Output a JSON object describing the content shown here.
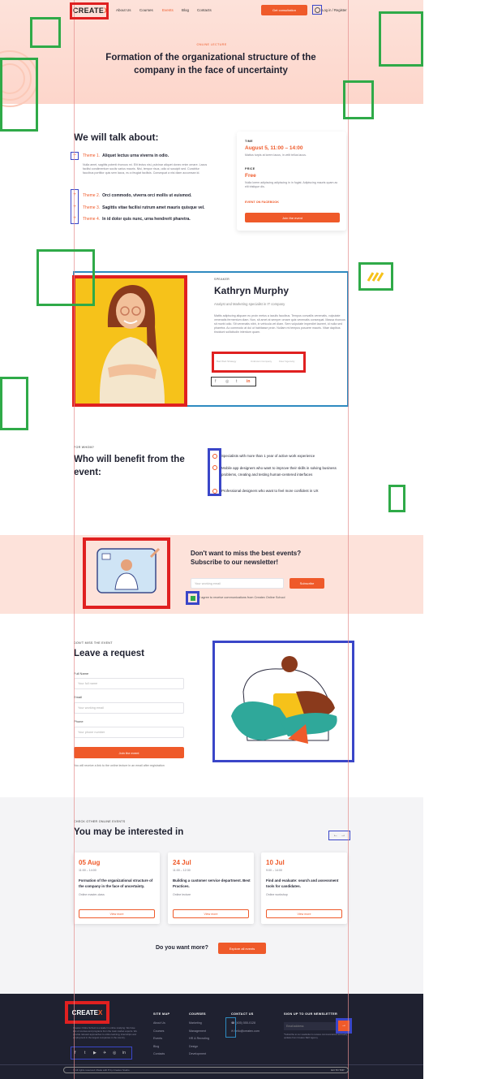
{
  "header": {
    "logo_main": "CREATE",
    "logo_x": "X",
    "nav": [
      "About Us",
      "Courses",
      "Events",
      "Blog",
      "Contacts"
    ],
    "consult_btn": "Get consultation",
    "login": "Log in / Register"
  },
  "hero": {
    "category": "ONLINE LECTURE",
    "title": "Formation of the organizational structure of the company in the face of uncertainty"
  },
  "talk": {
    "heading": "We will talk about:",
    "themes": [
      {
        "num": "Theme 1.",
        "text": "Aliquet lectus urna viverra in odio."
      },
      {
        "num": "Theme 2.",
        "text": "Orci commodo, viverra orci mollis ut euismod."
      },
      {
        "num": "Theme 3.",
        "text": "Sagittis vitae facilisi rutrum amet mauris quisque vel."
      },
      {
        "num": "Theme 4.",
        "text": "In id dolor quis nunc, urna hendrerit pharetra."
      }
    ],
    "theme1_desc": "Nulla amet, sagittis potenti rhoncus mi. Elit lectus nisi, pulvinar aliquet donec enim ornare. Lacus facilisi condimentum sociis varius mauris. Nisi, tempor risus, odio ut suscipit sed. Curabitur faucibus porttitor quis sem lacus, eu a feugiat facilisis. Consequat a nisi diam accumsan id."
  },
  "info_card": {
    "time_label": "TIME",
    "time_value": "August 5, 11:00 – 14:00",
    "time_desc": "Mattus turpis at lorem lacus, in velit tellus lacus.",
    "price_label": "PRICE",
    "price_value": "Free",
    "price_desc": "Nulla lorem adipiscing adipiscing in in fugiat. Adipiscing mauris quam ac elit tristique dis.",
    "facebook_link": "EVENT ON FACEBOOK",
    "join_btn": "Join the event"
  },
  "speaker": {
    "label": "SPEAKER",
    "name": "Kathryn Murphy",
    "role": "Analyst and Marketing specialist in IT company",
    "bio": "Mattis adipiscing aliquam eu proin metus a iaculis faucibus. Tempus convallis venenatis, vulputate venenatis fermentum diam. Non, sit amet at semper ornare quis venenatis consequat. Massa rhoncus sit morbi odio. Sit venenatis nibh, in vehicula vel diam. Sem vulputate imperdiet laoreet, id nulla sed pharetra. Ac commodo at dui ut habitasse proin. Nullam mi tempus posuere mauris. Vitae dapibus tincidunt sollicitudin interdum quam.",
    "partners": [
      "Bad Web Strategy",
      "Unknown Company",
      "Flow Ingenuity"
    ]
  },
  "benefit": {
    "label": "FOR WHOM?",
    "heading": "Who will benefit from the event:",
    "items": [
      "Specialists with more than 1 year of active work experience",
      "Mobile app designers who want to improve their skills in solving business problems, creating and testing human-centered interfaces",
      "Professional designers who want to feel more confident in UX"
    ]
  },
  "newsletter": {
    "heading": "Don't want to miss the best events? Subscribe to our newsletter!",
    "placeholder": "Your working email",
    "btn": "Subscribe",
    "agree": "I agree to receive communications from Createx Online School"
  },
  "request": {
    "label": "DON'T MISS THE EVENT",
    "heading": "Leave a request",
    "fields": [
      {
        "label": "Full Name",
        "placeholder": "Your full name"
      },
      {
        "label": "Email",
        "placeholder": "Your working email"
      },
      {
        "label": "Phone",
        "placeholder": "Your phone number"
      }
    ],
    "btn": "Join the event",
    "note": "You will receive a link to the online lecture in an email after registration"
  },
  "related": {
    "label": "CHECK OTHER ONLINE EVENTS",
    "heading": "You may be interested in",
    "events": [
      {
        "day": "05 Aug",
        "time": "11:00 – 14:00",
        "title": "Formation of the organizational structure of the company in the face of uncertainty.",
        "type": "Online master-class",
        "btn": "View more"
      },
      {
        "day": "24 Jul",
        "time": "11:00 – 12:30",
        "title": "Building a customer service department. Best Practices.",
        "type": "Online lecture",
        "btn": "View more"
      },
      {
        "day": "10 Jul",
        "time": "9:00 – 14:00",
        "title": "Find and evaluate: search and assessment tools for candidates.",
        "type": "Online workshop",
        "btn": "View more"
      }
    ],
    "more_text": "Do you want more?",
    "more_btn": "Explore all events"
  },
  "footer": {
    "about": "Createx Online School is a leader in online studying. We have lots of courses and programs from the main market experts. We provide relevant approaches to online learning, internships and employment in the largest companies in the country.",
    "sitemap_title": "SITE MAP",
    "sitemap": [
      "About Us",
      "Courses",
      "Events",
      "Blog",
      "Contacts"
    ],
    "courses_title": "COURSES",
    "courses": [
      "Marketing",
      "Management",
      "HR & Recruting",
      "Design",
      "Development"
    ],
    "contact_title": "CONTACT US",
    "phone": "(405) 555-0128",
    "email": "hello@createx.com",
    "newsletter_title": "SIGN UP TO OUR NEWSLETTER",
    "newsletter_placeholder": "Email address",
    "newsletter_note": "*Subscribe to our newsletter to receive communications and early updates from Createx SEO Agency.",
    "copyright": "© All rights reserved. Made with ♥ by Createx Studio",
    "go_top": "GO TO TOP"
  },
  "colors": {
    "accent": "#ef5a2a",
    "dark": "#1f2130",
    "hero": "#fde2da"
  }
}
